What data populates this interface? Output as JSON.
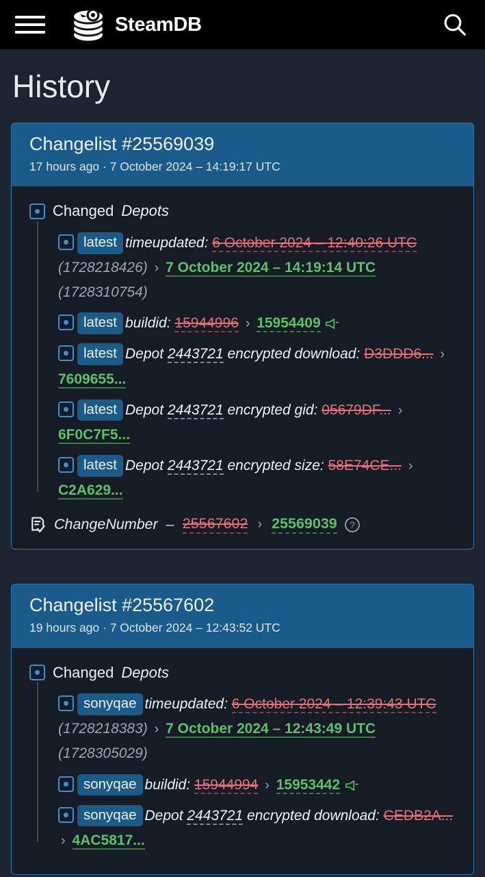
{
  "topbar": {
    "menu_icon": "hamburger-menu-icon",
    "brand": "SteamDB",
    "logo_icon": "steamdb-logo-icon",
    "search_icon": "search-icon"
  },
  "page": {
    "title": "History"
  },
  "colors": {
    "accent_blue": "#1b5b8c",
    "border_blue": "#2a7ab0",
    "old_red": "#e8707a",
    "new_green": "#5fc06a",
    "page_bg": "#1b2430",
    "card_bg": "#151c26",
    "topbar_bg": "#000000"
  },
  "changelists": [
    {
      "title": "Changelist #25569039",
      "subtitle": "17 hours ago · 7 October 2024 – 14:19:17 UTC",
      "section_label_plain": "Changed",
      "section_label_em": "Depots",
      "section_icon": "change-dot-icon",
      "changes": [
        {
          "icon": "change-dot-icon",
          "branch": "latest",
          "key": "timeupdated:",
          "old": "6 October 2024 – 12:40:26 UTC",
          "old_raw": "(1728218426)",
          "new": "7 October 2024 – 14:19:14 UTC",
          "new_raw": "(1728310754)",
          "arrow": "›"
        },
        {
          "icon": "change-dot-icon",
          "branch": "latest",
          "key": "buildid:",
          "old": "15944996",
          "new": "15954409",
          "arrow": "›",
          "trailing_icon": "megaphone-icon"
        },
        {
          "icon": "change-dot-icon",
          "branch": "latest",
          "key_prefix": "Depot",
          "depot": "2443721",
          "key_suffix": "encrypted download:",
          "old": "D3DDD6...",
          "new": "7609655...",
          "arrow": "›"
        },
        {
          "icon": "change-dot-icon",
          "branch": "latest",
          "key_prefix": "Depot",
          "depot": "2443721",
          "key_suffix": "encrypted gid:",
          "old": "05679DF...",
          "new": "6F0C7F5...",
          "arrow": "›"
        },
        {
          "icon": "change-dot-icon",
          "branch": "latest",
          "key_prefix": "Depot",
          "depot": "2443721",
          "key_suffix": "encrypted size:",
          "old": "58E74CE...",
          "new": "C2A629...",
          "arrow": "›"
        }
      ],
      "changenumber": {
        "icon": "document-check-icon",
        "label": "ChangeNumber",
        "dash": "–",
        "old": "25567602",
        "arrow": "›",
        "new": "25569039",
        "help_icon": "question-mark-icon"
      }
    },
    {
      "title": "Changelist #25567602",
      "subtitle": "19 hours ago · 7 October 2024 – 12:43:52 UTC",
      "section_label_plain": "Changed",
      "section_label_em": "Depots",
      "section_icon": "change-dot-icon",
      "changes": [
        {
          "icon": "change-dot-icon",
          "branch": "sonyqae",
          "key": "timeupdated:",
          "old": "6 October 2024 – 12:39:43 UTC",
          "old_raw": "(1728218383)",
          "new": "7 October 2024 – 12:43:49 UTC",
          "new_raw": "(1728305029)",
          "arrow": "›"
        },
        {
          "icon": "change-dot-icon",
          "branch": "sonyqae",
          "key": "buildid:",
          "old": "15944994",
          "new": "15953442",
          "arrow": "›",
          "trailing_icon": "megaphone-icon"
        },
        {
          "icon": "change-dot-icon",
          "branch": "sonyqae",
          "key_prefix": "Depot",
          "depot": "2443721",
          "key_suffix": "encrypted download:",
          "old": "CEDB2A...",
          "new": "4AC5817...",
          "arrow": "›"
        }
      ]
    }
  ]
}
